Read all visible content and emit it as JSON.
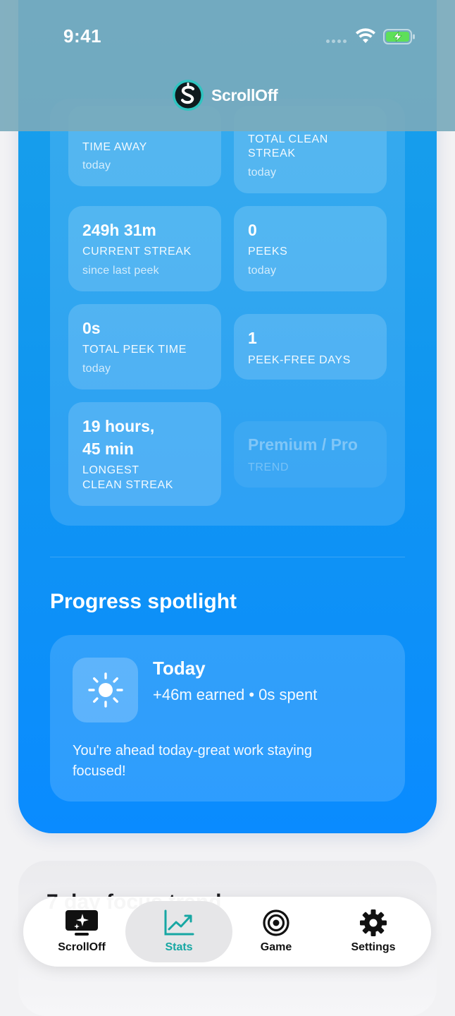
{
  "status_bar": {
    "time": "9:41"
  },
  "header": {
    "app_name": "ScrollOff"
  },
  "stats": {
    "time_away": {
      "label": "TIME AWAY",
      "sub": "today"
    },
    "total_clean_streak": {
      "label_line1": "TOTAL CLEAN",
      "label_line2": "STREAK",
      "sub": "today"
    },
    "current_streak": {
      "value": "249h 31m",
      "label": "CURRENT STREAK",
      "sub": "since last peek"
    },
    "peeks": {
      "value": "0",
      "label": "PEEKS",
      "sub": "today"
    },
    "total_peek_time": {
      "value": "0s",
      "label": "TOTAL PEEK TIME",
      "sub": "today"
    },
    "peek_free_days": {
      "value": "1",
      "label": "PEEK-FREE DAYS"
    },
    "longest_clean_streak": {
      "value_line1": "19 hours,",
      "value_line2": "45 min",
      "label_line1": "LONGEST",
      "label_line2": "CLEAN STREAK"
    },
    "trend": {
      "value": "Premium / Pro",
      "label": "TREND"
    }
  },
  "spotlight": {
    "section_title": "Progress spotlight",
    "title": "Today",
    "subtitle": "+46m earned • 0s spent",
    "message": "You're ahead today-great work staying focused!",
    "icon": "sun-icon"
  },
  "next_section": {
    "title_partial": "7 day focus trend"
  },
  "tabbar": {
    "tabs": [
      {
        "label": "ScrollOff",
        "icon": "screen-sparkle-icon"
      },
      {
        "label": "Stats",
        "icon": "chart-trend-icon",
        "active": true
      },
      {
        "label": "Game",
        "icon": "target-icon"
      },
      {
        "label": "Settings",
        "icon": "gear-icon"
      }
    ]
  },
  "colors": {
    "accent": "#17a7a3",
    "card_blue": "#1197ef",
    "header": "#7aaabc"
  }
}
